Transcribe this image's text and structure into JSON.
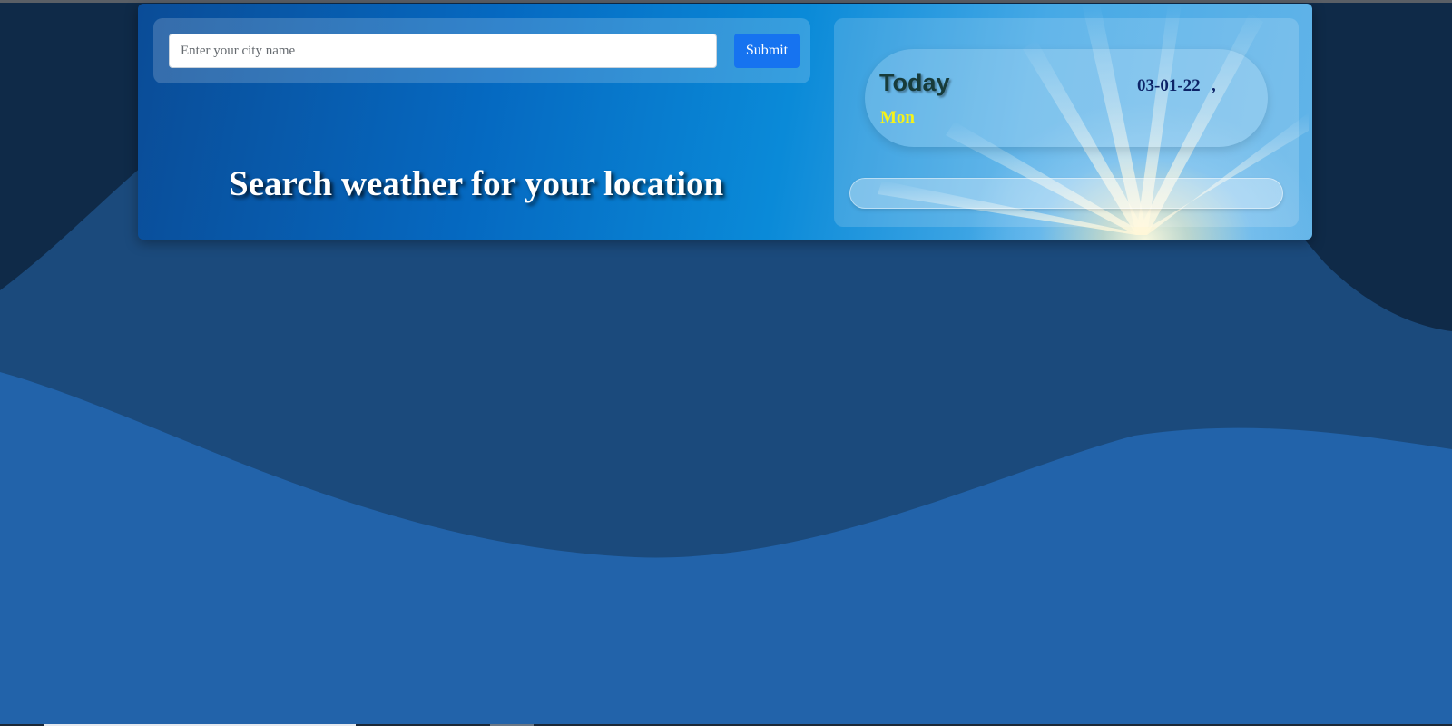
{
  "search": {
    "placeholder": "Enter your city name",
    "value": "",
    "submit_label": "Submit"
  },
  "headline": "Search weather for your location",
  "today_card": {
    "label": "Today",
    "date": "03-01-22",
    "separator": ",",
    "day": "Mon"
  },
  "colors": {
    "page_background": "#0f2a48",
    "wave_mid": "#1b4a7c",
    "wave_front": "#2263aa",
    "submit_button": "#1673f0",
    "date_text": "#0d2367",
    "day_text": "#f5f219"
  }
}
